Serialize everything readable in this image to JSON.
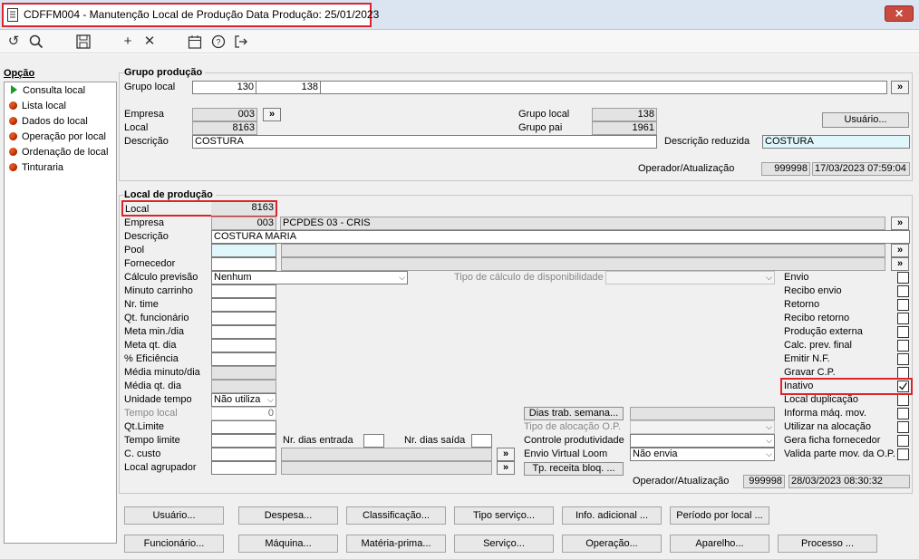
{
  "window": {
    "title": "CDFFM004 - Manutenção Local de Produção Data Produção: 25/01/2023",
    "close": "✕"
  },
  "sidebar": {
    "header": "Opção",
    "items": [
      {
        "label": "Consulta local",
        "icon": "play-icon"
      },
      {
        "label": "Lista local",
        "icon": "bullet-icon"
      },
      {
        "label": "Dados do local",
        "icon": "bullet-icon"
      },
      {
        "label": "Operação por local",
        "icon": "bullet-icon"
      },
      {
        "label": "Ordenação de local",
        "icon": "bullet-icon"
      },
      {
        "label": "Tinturaria",
        "icon": "bullet-icon"
      }
    ]
  },
  "grupo": {
    "legend": "Grupo produção",
    "grupo_local_label": "Grupo local",
    "grupo_local_a": "130",
    "grupo_local_b": "138",
    "empresa_label": "Empresa",
    "empresa": "003",
    "local_label": "Local",
    "local": "8163",
    "descricao_label": "Descrição",
    "descricao": "COSTURA",
    "grupo_local2_label": "Grupo local",
    "grupo_local2": "138",
    "grupo_pai_label": "Grupo pai",
    "grupo_pai": "1961",
    "usuario_btn": "Usuário...",
    "desc_reduzida_label": "Descrição reduzida",
    "desc_reduzida": "COSTURA",
    "operador_label": "Operador/Atualização",
    "operador": "999998",
    "atualizacao": "17/03/2023 07:59:04",
    "arrow": "»"
  },
  "local": {
    "legend": "Local de produção",
    "local_label": "Local",
    "local": "8163",
    "empresa_label": "Empresa",
    "empresa": "003",
    "empresa_nome": "PCPDES 03 - CRIS",
    "descricao_label": "Descrição",
    "descricao": "COSTURA MARIA",
    "pool_label": "Pool",
    "fornecedor_label": "Fornecedor",
    "calculo_label": "Cálculo previsão",
    "calculo": "Nenhum",
    "tipo_calc_label": "Tipo de cálculo de disponibilidade",
    "minuto_carrinho_label": "Minuto carrinho",
    "nr_time_label": "Nr. time",
    "qt_func_label": "Qt. funcionário",
    "meta_min_label": "Meta min./dia",
    "meta_qt_label": "Meta qt. dia",
    "eficiencia_label": "% Eficiência",
    "media_min_label": "Média minuto/dia",
    "media_qt_label": "Média qt. dia",
    "unidade_label": "Unidade tempo",
    "unidade": "Não utiliza",
    "tempo_local_label": "Tempo local",
    "tempo_local": "0",
    "qt_limite_label": "Qt.Limite",
    "tempo_limite_label": "Tempo limite",
    "ccusto_label": "C. custo",
    "agrupador_label": "Local agrupador",
    "nr_entrada_label": "Nr. dias entrada",
    "nr_saida_label": "Nr. dias saída",
    "dias_trab_btn": "Dias trab. semana...",
    "tipo_alocacao_label": "Tipo de alocação O.P.",
    "controle_label": "Controle produtividade",
    "envio_loom_label": "Envio Virtual Loom",
    "envio_loom": "Não envia",
    "tp_receita_btn": "Tp. receita bloq. ...",
    "operador_label": "Operador/Atualização",
    "operador": "999998",
    "atualizacao": "28/03/2023 08:30:32",
    "checks": [
      {
        "label": "Envio",
        "checked": false
      },
      {
        "label": "Recibo envio",
        "checked": false
      },
      {
        "label": "Retorno",
        "checked": false
      },
      {
        "label": "Recibo retorno",
        "checked": false
      },
      {
        "label": "Produção externa",
        "checked": false
      },
      {
        "label": "Calc. prev. final",
        "checked": false
      },
      {
        "label": "Emitir N.F.",
        "checked": false
      },
      {
        "label": "Gravar C.P.",
        "checked": false
      },
      {
        "label": "Inativo",
        "checked": true
      },
      {
        "label": "Local duplicação",
        "checked": false
      },
      {
        "label": "Informa máq. mov.",
        "checked": false
      },
      {
        "label": "Utilizar na alocação",
        "checked": false
      },
      {
        "label": "Gera ficha fornecedor",
        "checked": false
      },
      {
        "label": "Valida parte mov. da O.P.",
        "checked": false
      }
    ]
  },
  "buttons_row1": [
    "Usuário...",
    "Despesa...",
    "Classificação...",
    "Tipo serviço...",
    "Info. adicional ...",
    "Período por local ..."
  ],
  "buttons_row2": [
    "Funcionário...",
    "Máquina...",
    "Matéria-prima...",
    "Serviço...",
    "Operação...",
    "Aparelho...",
    "Processo ..."
  ]
}
